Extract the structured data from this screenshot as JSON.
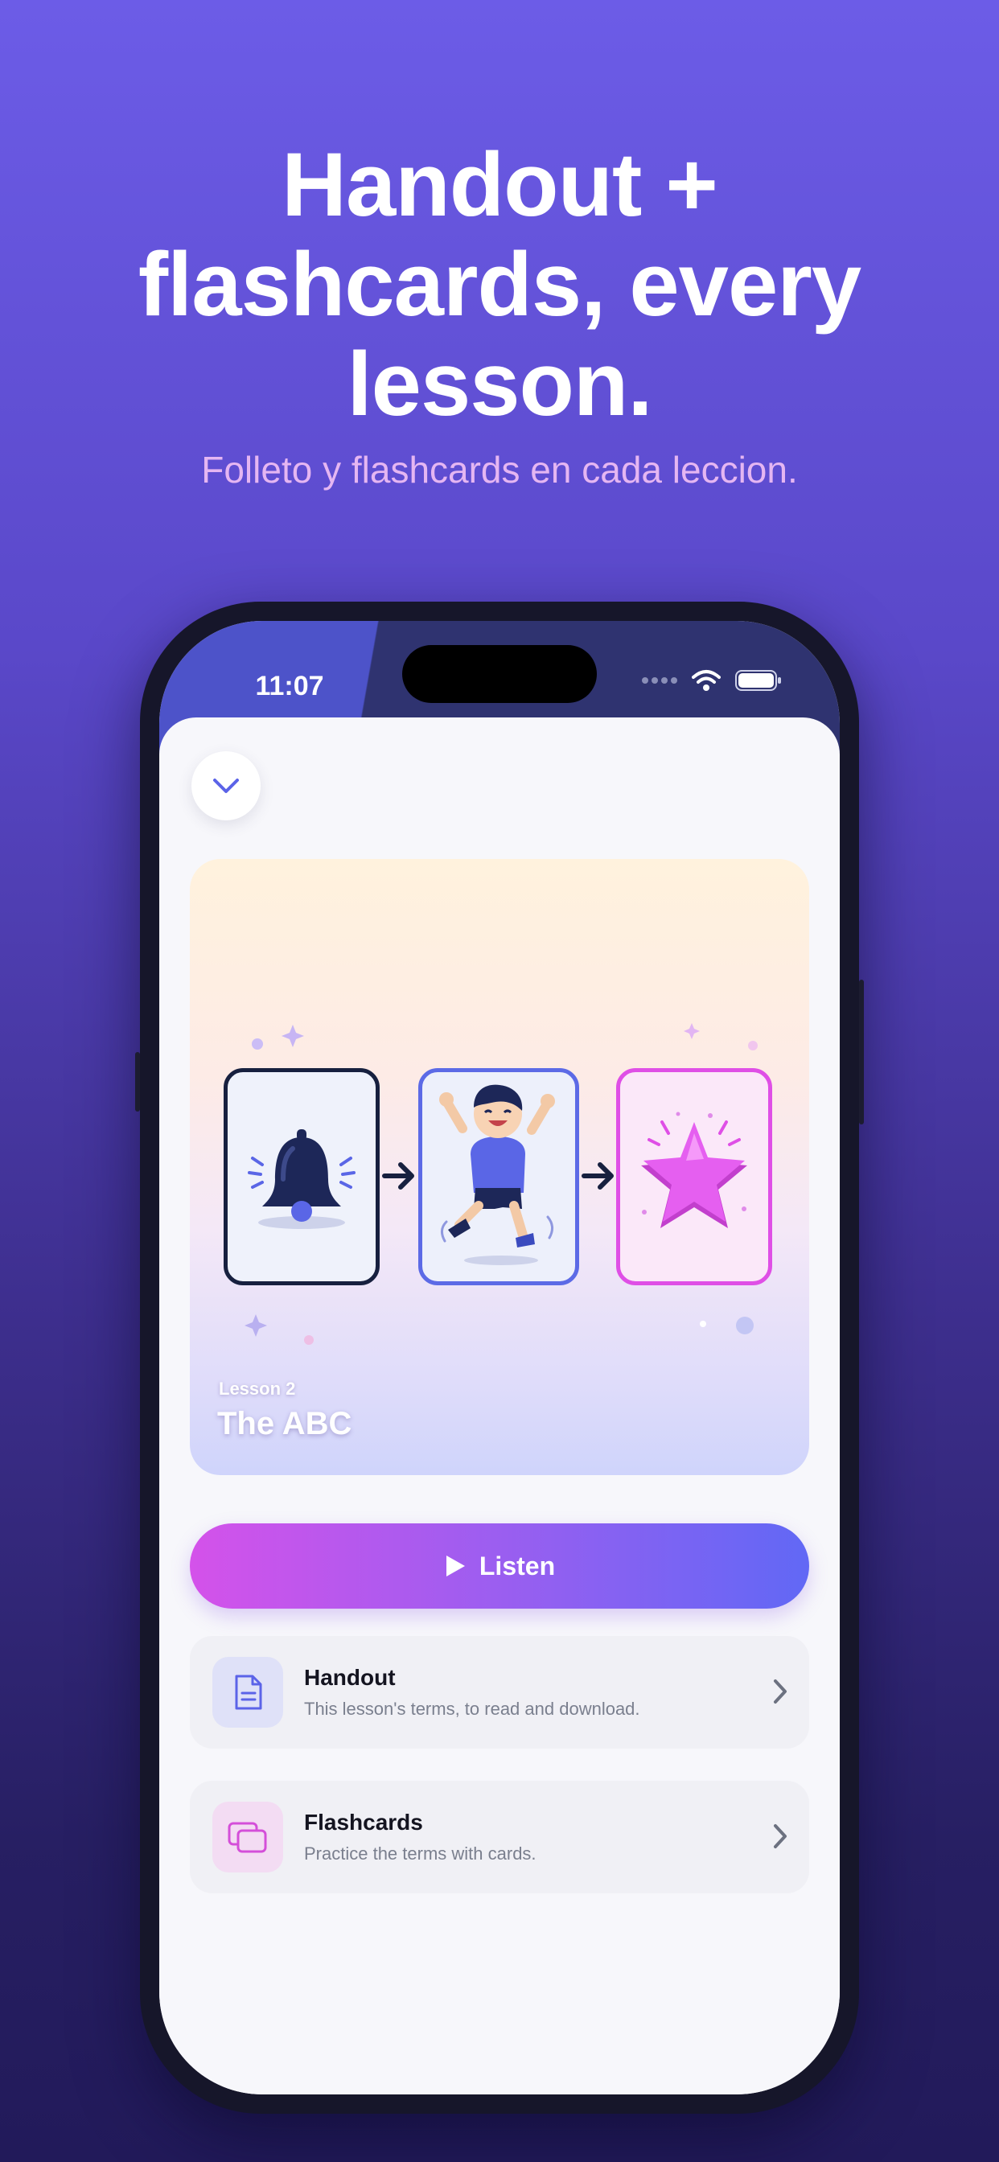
{
  "promo": {
    "headline_line1": "Handout +",
    "headline_line2": "flashcards, every",
    "headline_line3": "lesson.",
    "subheadline": "Folleto y flashcards en cada leccion."
  },
  "status_bar": {
    "time": "11:07"
  },
  "lesson": {
    "label": "Lesson 2",
    "title": "The ABC",
    "sequence_icons": [
      "bell-icon",
      "jumping-boy-illustration",
      "star-icon"
    ]
  },
  "actions": {
    "listen_label": "Listen",
    "rows": [
      {
        "title": "Handout",
        "subtitle": "This lesson's terms, to read and download.",
        "icon": "document-icon"
      },
      {
        "title": "Flashcards",
        "subtitle": "Practice the terms with cards.",
        "icon": "cards-icon"
      }
    ]
  },
  "colors": {
    "accent_start": "#d452ea",
    "accent_end": "#6168f5",
    "background_top": "#6c5ce7",
    "background_bottom": "#221a5a"
  }
}
